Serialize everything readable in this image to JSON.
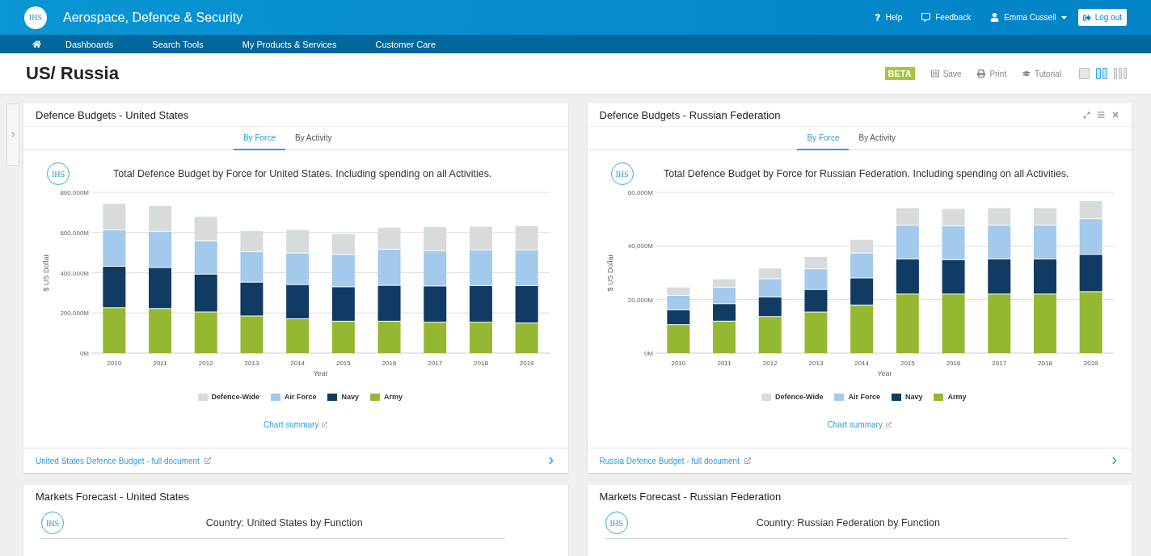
{
  "topbar": {
    "logo_text": "IHS",
    "title": "Aerospace, Defence & Security",
    "help": "Help",
    "feedback": "Feedback",
    "user": "Emma Cussell",
    "logout": "Log out"
  },
  "nav": {
    "items": [
      "Dashboards",
      "Search Tools",
      "My Products & Services",
      "Customer Care"
    ]
  },
  "page": {
    "title": "US/ Russia",
    "badge": "BETA",
    "actions": [
      {
        "kind": "save",
        "label": "Save"
      },
      {
        "kind": "print",
        "label": "Print"
      },
      {
        "kind": "tutorial",
        "label": "Tutorial"
      }
    ],
    "layouts": [
      {
        "kind": "single",
        "selected": false
      },
      {
        "kind": "double",
        "selected": true
      },
      {
        "kind": "triple",
        "selected": false
      }
    ]
  },
  "budget_cards": [
    {
      "title": "Defence Budgets - United States",
      "header_icons": false,
      "tabs": [
        {
          "label": "By Force",
          "selected": true
        },
        {
          "label": "By Activity",
          "selected": false
        }
      ],
      "logo_text": "IHS",
      "chart_title": "Total Defence Budget by Force for United States. Including spending on all Activities.",
      "summary_link": "Chart summary",
      "document_link": "United States Defence Budget - full document",
      "chart_data": {
        "type": "bar",
        "stacked": true,
        "orientation": "vertical",
        "grid": true,
        "legend": true,
        "xlabel": "Year",
        "ylabel": "$ US Dollar",
        "categories": [
          "2010",
          "2011",
          "2012",
          "2013",
          "2014",
          "2015",
          "2016",
          "2017",
          "2018",
          "2019"
        ],
        "ylim": [
          0,
          800000
        ],
        "yticks": [
          {
            "value": 0,
            "label": "0M"
          },
          {
            "value": 200000,
            "label": "200,000M"
          },
          {
            "value": 400000,
            "label": "400,000M"
          },
          {
            "value": 600000,
            "label": "600,000M"
          },
          {
            "value": 800000,
            "label": "800,000M"
          }
        ],
        "series": [
          {
            "name": "Army",
            "color": "#95b833",
            "values": [
              224000,
              220000,
              203000,
              183000,
              169000,
              157000,
              157000,
              152000,
              152000,
              148000
            ]
          },
          {
            "name": "Navy",
            "color": "#113b63",
            "values": [
              206000,
              204000,
              188000,
              168000,
              170000,
              171000,
              178000,
              180000,
              182000,
              186000
            ]
          },
          {
            "name": "Air Force",
            "color": "#a3c9ec",
            "values": [
              181000,
              180000,
              166000,
              152000,
              157000,
              161000,
              180000,
              176000,
              178000,
              178000
            ]
          },
          {
            "name": "Defence-Wide",
            "color": "#d8dbdb",
            "values": [
              133000,
              128000,
              121000,
              105000,
              117000,
              103000,
              109000,
              119000,
              117000,
              120000
            ]
          }
        ]
      }
    },
    {
      "title": "Defence Budgets - Russian Federation",
      "header_icons": true,
      "tabs": [
        {
          "label": "By Force",
          "selected": true
        },
        {
          "label": "By Activity",
          "selected": false
        }
      ],
      "logo_text": "IHS",
      "chart_title": "Total Defence Budget by Force for Russian Federation. Including spending on all Activities.",
      "summary_link": "Chart summary",
      "document_link": "Russia Defence Budget - full document",
      "chart_data": {
        "type": "bar",
        "stacked": true,
        "orientation": "vertical",
        "grid": true,
        "legend": true,
        "xlabel": "Year",
        "ylabel": "$ US Dollar",
        "categories": [
          "2010",
          "2011",
          "2012",
          "2013",
          "2014",
          "2015",
          "2016",
          "2017",
          "2018",
          "2019"
        ],
        "ylim": [
          0,
          60000
        ],
        "yticks": [
          {
            "value": 0,
            "label": "0M"
          },
          {
            "value": 20000,
            "label": "20,000M"
          },
          {
            "value": 40000,
            "label": "40,000M"
          },
          {
            "value": 60000,
            "label": "60,000M"
          }
        ],
        "series": [
          {
            "name": "Army",
            "color": "#95b833",
            "values": [
              10500,
              11800,
              13500,
              15200,
              17800,
              21900,
              21900,
              21900,
              21900,
              22800
            ]
          },
          {
            "name": "Navy",
            "color": "#113b63",
            "values": [
              5500,
              6500,
              7300,
              8400,
              10100,
              13100,
              12800,
              13100,
              13100,
              13900
            ]
          },
          {
            "name": "Air Force",
            "color": "#a3c9ec",
            "values": [
              5400,
              6100,
              6800,
              7700,
              9300,
              12600,
              12600,
              12600,
              12600,
              13300
            ]
          },
          {
            "name": "Defence-Wide",
            "color": "#d8dbdb",
            "values": [
              3100,
              3200,
              4000,
              4600,
              5100,
              6500,
              6500,
              6500,
              6500,
              6700
            ]
          }
        ]
      }
    }
  ],
  "forecast_cards": [
    {
      "title": "Markets Forecast - United States",
      "logo_text": "IHS",
      "subtitle": "Country: United States by Function"
    },
    {
      "title": "Markets Forecast - Russian Federation",
      "logo_text": "IHS",
      "subtitle": "Country: Russian Federation by Function"
    }
  ]
}
